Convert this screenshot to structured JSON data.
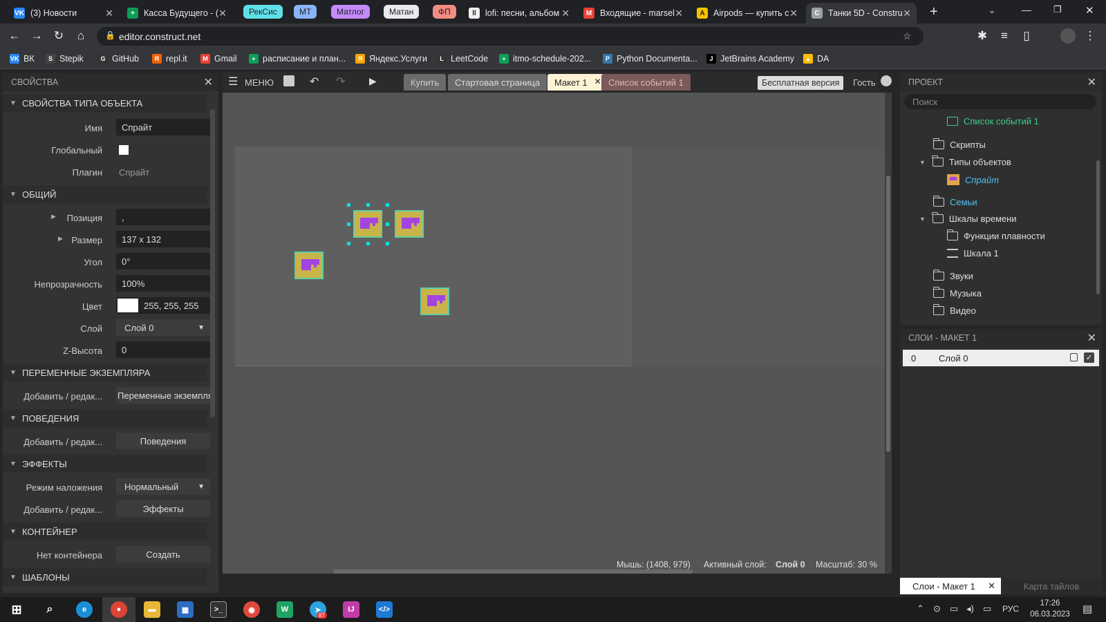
{
  "browser": {
    "tabs": [
      {
        "label": "(3) Новости",
        "favicon_color": "#2787f5",
        "favicon_glyph": "VK"
      },
      {
        "label": "Касса Будущего - (",
        "favicon_color": "#0f9d58",
        "favicon_glyph": "+"
      },
      {
        "label": "lofi: песни, альбом",
        "favicon_color": "#f1f1f1",
        "favicon_glyph": "ll"
      },
      {
        "label": "Входящие - marsel",
        "favicon_color": "#ea4335",
        "favicon_glyph": "M"
      },
      {
        "label": "Airpods — купить с",
        "favicon_color": "#f6c200",
        "favicon_glyph": "A"
      },
      {
        "label": "Танки 5D - Constru",
        "favicon_color": "#9aa0a6",
        "favicon_glyph": "C"
      }
    ],
    "tab_groups": [
      {
        "label": "РекСис",
        "color": "#5ee0e8"
      },
      {
        "label": "МТ",
        "color": "#8ab4f8"
      },
      {
        "label": "Матлог",
        "color": "#c58af9"
      },
      {
        "label": "Матан",
        "color": "#e8eaed"
      },
      {
        "label": "ФП",
        "color": "#f28b82"
      }
    ],
    "new_tab": "+",
    "url": "editor.construct.net",
    "bookmarks": [
      {
        "label": "ВК",
        "color": "#2787f5",
        "glyph": "VK"
      },
      {
        "label": "Stepik",
        "color": "#444",
        "glyph": "S"
      },
      {
        "label": "GitHub",
        "color": "#333",
        "glyph": "G"
      },
      {
        "label": "repl.it",
        "color": "#f26207",
        "glyph": "R"
      },
      {
        "label": "Gmail",
        "color": "#ea4335",
        "glyph": "M"
      },
      {
        "label": "расписание и план...",
        "color": "#0f9d58",
        "glyph": "+"
      },
      {
        "label": "Яндекс.Услуги",
        "color": "#f6a500",
        "glyph": "Я"
      },
      {
        "label": "LeetCode",
        "color": "#333",
        "glyph": "L"
      },
      {
        "label": "itmo-schedule-202...",
        "color": "#0f9d58",
        "glyph": "+"
      },
      {
        "label": "Python Documenta...",
        "color": "#3776ab",
        "glyph": "P"
      },
      {
        "label": "JetBrains Academy",
        "color": "#000",
        "glyph": "J"
      },
      {
        "label": "DA",
        "color": "#fbbc04",
        "glyph": "▲"
      }
    ]
  },
  "properties_panel": {
    "title": "СВОЙСТВА",
    "sections": {
      "object_type": "СВОЙСТВА ТИПА ОБЪЕКТА",
      "common": "ОБЩИЙ",
      "instance_vars": "ПЕРЕМЕННЫЕ ЭКЗЕМПЛЯРА",
      "behaviors": "ПОВЕДЕНИЯ",
      "effects": "ЭФФЕКТЫ",
      "container": "КОНТЕЙНЕР",
      "templates": "ШАБЛОНЫ"
    },
    "fields": {
      "name_label": "Имя",
      "name_value": "Спрайт",
      "global_label": "Глобальный",
      "plugin_label": "Плагин",
      "plugin_value": "Спрайт",
      "position_label": "Позиция",
      "position_value": ",",
      "size_label": "Размер",
      "size_value": "137 x 132",
      "angle_label": "Угол",
      "angle_value": "0°",
      "opacity_label": "Непрозрачность",
      "opacity_value": "100%",
      "color_label": "Цвет",
      "color_value": "255, 255, 255",
      "layer_label": "Слой",
      "layer_value": "Слой 0",
      "zheight_label": "Z-Высота",
      "zheight_value": "0",
      "add_edit_label": "Добавить / редак...",
      "instance_vars_value": "Переменные экземпляр",
      "behaviors_button": "Поведения",
      "blend_label": "Режим наложения",
      "blend_value": "Нормальный",
      "effects_button": "Эффекты",
      "no_container_label": "Нет контейнера",
      "create_button": "Создать"
    }
  },
  "toolbar": {
    "menu_label": "МЕНЮ",
    "buy_tab": "Купить",
    "start_tab": "Стартовая страница",
    "layout_tab": "Макет 1",
    "events_tab": "Список событий 1",
    "free_version": "Бесплатная версия",
    "guest": "Гость"
  },
  "status": {
    "mouse": "Мышь: (1408, 979)",
    "active_layer_label": "Активный слой:",
    "active_layer_value": "Слой 0",
    "zoom": "Масштаб: 30 %"
  },
  "project_panel": {
    "title": "ПРОЕКТ",
    "search_placeholder": "Поиск",
    "items": {
      "event_list": "Список событий 1",
      "scripts": "Скрипты",
      "object_types": "Типы объектов",
      "sprite": "Спрайт",
      "families": "Семьи",
      "timelines": "Шкалы времени",
      "easing": "Функции плавности",
      "timeline1": "Шкала 1",
      "sounds": "Звуки",
      "music": "Музыка",
      "video": "Видео"
    }
  },
  "layers_panel": {
    "title": "СЛОИ - МАКЕТ 1",
    "layer_index": "0",
    "layer_name": "Слой 0",
    "tab_layers": "Слои - Макет 1",
    "tab_tilemap": "Карта тайлов"
  },
  "taskbar": {
    "lang": "РУС",
    "time": "17:26",
    "date": "06.03.2023",
    "telegram_badge": "87"
  },
  "colors": {
    "accent_green": "#3ecf8e",
    "selected_italic": "#4fc3f7",
    "families_blue": "#4fc3f7",
    "sprite_fill": "#c9b44a",
    "sprite_purple": "#a344e0",
    "handle": "#00e5e5"
  }
}
